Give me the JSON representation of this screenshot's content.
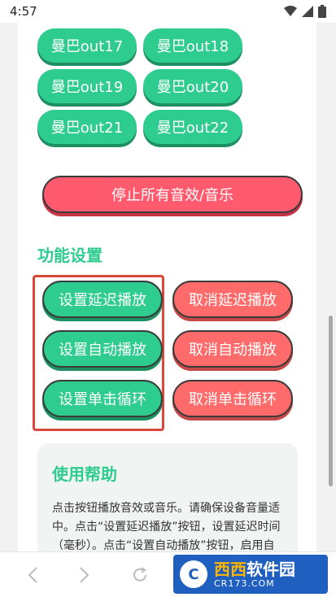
{
  "status_bar": {
    "time": "4:57"
  },
  "sound_buttons": [
    "曼巴out17",
    "曼巴out18",
    "曼巴out19",
    "曼巴out20",
    "曼巴out21",
    "曼巴out22"
  ],
  "stop_all_label": "停止所有音效/音乐",
  "section_title": "功能设置",
  "settings": {
    "left": [
      "设置延迟播放",
      "设置自动播放",
      "设置单击循环"
    ],
    "right": [
      "取消延迟播放",
      "取消自动播放",
      "取消单击循环"
    ]
  },
  "help": {
    "title": "使用帮助",
    "text": "点击按钮播放音效或音乐。请确保设备音量适中。点击“设置延迟播放”按钮，设置延迟时间（毫秒）。点击“设置自动播放”按钮，启用自动播放功"
  },
  "watermark": {
    "brand_a": "西西",
    "brand_b": "软件园",
    "sub": "CR173.COM"
  },
  "colors": {
    "green": "#2ecc8f",
    "red": "#ff5a6e",
    "salmon": "#ff6b6b",
    "highlight": "#d9483b"
  }
}
